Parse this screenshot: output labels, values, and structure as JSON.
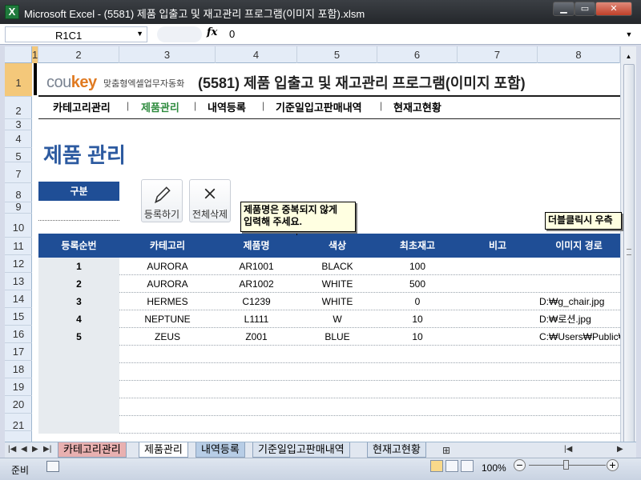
{
  "window": {
    "title": "Microsoft Excel - (5581) 제품 입출고 및 재고관리 프로그램(이미지 포함).xlsm",
    "app_icon": "X",
    "min_glyph": "▁",
    "max_glyph": "▭",
    "close_glyph": "✕"
  },
  "formula_bar": {
    "name_box": "R1C1",
    "fx_label": "fx",
    "value": "0"
  },
  "columns": [
    "1",
    "2",
    "3",
    "4",
    "5",
    "6",
    "7",
    "8"
  ],
  "rows": [
    "1",
    "2",
    "3",
    "4",
    "5",
    "7",
    "8",
    "9",
    "10",
    "11",
    "12",
    "13",
    "14",
    "15",
    "16",
    "17",
    "18",
    "19",
    "20",
    "21"
  ],
  "brand": {
    "logo_plain": "cou",
    "logo_bold": "key",
    "tagline": "맞춤형엑셀업무자동화",
    "app_title": "(5581) 제품 입출고 및 재고관리 프로그램(이미지 포함)"
  },
  "nav": {
    "items": [
      "카테고리관리",
      "제품관리",
      "내역등록",
      "기준일입고판매내역",
      "현재고현황"
    ],
    "active_color": "#2e8b3e"
  },
  "page_title": "제품 관리",
  "filter": {
    "label": "구분"
  },
  "buttons": {
    "register": "등록하기",
    "delete_all": "전체삭제"
  },
  "memos": {
    "memo1_line1": "제품명은 중복되지 않게",
    "memo1_line2": "입력해 주세요.",
    "memo2": "더블클릭시 우측"
  },
  "table": {
    "headers": [
      "등록순번",
      "카테고리",
      "제품명",
      "색상",
      "최초재고",
      "비고",
      "이미지 경로"
    ],
    "rows": [
      [
        "1",
        "AURORA",
        "AR1001",
        "BLACK",
        "100",
        "",
        ""
      ],
      [
        "2",
        "AURORA",
        "AR1002",
        "WHITE",
        "500",
        "",
        ""
      ],
      [
        "3",
        "HERMES",
        "C1239",
        "WHITE",
        "0",
        "",
        "D:₩g_chair.jpg"
      ],
      [
        "4",
        "NEPTUNE",
        "L1111",
        "W",
        "10",
        "",
        "D:₩로션.jpg"
      ],
      [
        "5",
        "ZEUS",
        "Z001",
        "BLUE",
        "10",
        "",
        "C:₩Users₩Public₩P"
      ]
    ]
  },
  "sheet_tabs": [
    "카테고리관리",
    "제품관리",
    "내역등록",
    "기준일입고판매내역",
    "현재고현황"
  ],
  "sheet_tab_colors": [
    "#e8b0b0",
    "#ffffff",
    "#b7cde6",
    "#d9e2ee",
    "#d9e2ee"
  ],
  "status": {
    "ready": "준비",
    "zoom": "100%",
    "zoom_fraction": 0.5
  },
  "colors": {
    "header_blue": "#1f4e96",
    "title_blue": "#2c5aa0",
    "accent_orange": "#e07a21"
  }
}
